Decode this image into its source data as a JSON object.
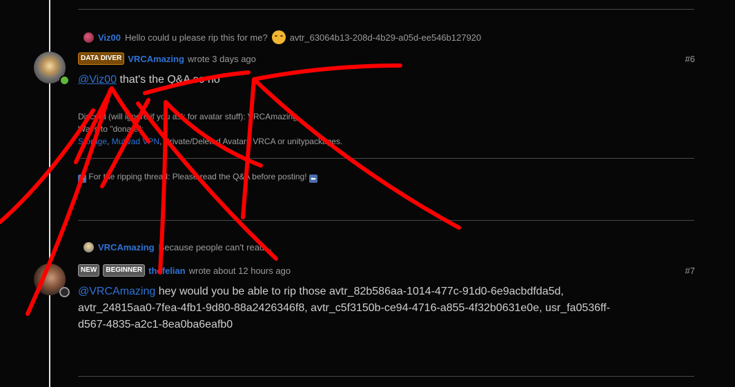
{
  "reply1": {
    "user": "Viz00",
    "text": "Hello could u please rip this for me?",
    "trailing": "avtr_63064b13-208d-4b29-a05d-ee546b127920"
  },
  "post6": {
    "badge": "DATA DIVER",
    "author": "VRCAmazing",
    "time": "wrote 3 days ago",
    "number": "#6",
    "mention": "@Viz00",
    "body": "that's the Q&A so no",
    "sig_line1": "Discord (will ignore if you ask for avatar stuff): VRCAmazing",
    "sig_line2": "Ways to \"donate\":",
    "sig_link1": "Storage",
    "sig_sep1": ", ",
    "sig_link2": "Mullvad VPN",
    "sig_rest": ", Private/Deleted Avatars VRCA or unitypackages.",
    "sig_line4": "For the ripping thread: Please read the Q&A before posting!"
  },
  "reply2": {
    "user": "VRCAmazing",
    "text": "Because people can't read..."
  },
  "post7": {
    "badge1": "NEW",
    "badge2": "BEGINNER",
    "author": "thefelian",
    "time": "wrote about 12 hours ago",
    "number": "#7",
    "mention": "@VRCAmazing",
    "body_line1": "hey would you be able to rip those avtr_82b586aa-1014-477c-91d0-6e9acbdfda5d,",
    "body_line2": "avtr_24815aa0-7fea-4fb1-9d80-88a2426346f8, avtr_c5f3150b-ce94-4716-a855-4f32b0631e0e, usr_fa0536ff-",
    "body_line3": "d567-4835-a2c1-8ea0ba6eafb0"
  },
  "colors": {
    "background": "#070707",
    "link": "#2f73d6",
    "annotation": "#ff0000",
    "online": "#5fb83a"
  },
  "icons": {
    "emoji": "smiling-face-icon",
    "arrows": "arrow-icon"
  }
}
